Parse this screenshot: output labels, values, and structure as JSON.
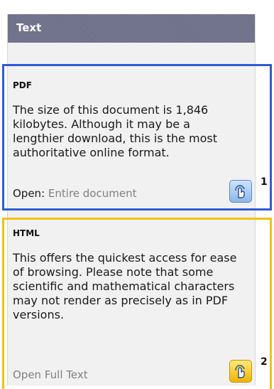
{
  "header": {
    "title": "Text"
  },
  "pdf": {
    "title": "PDF",
    "body": "The size of this document is 1,846 kilobytes. Although it may be a lengthier download, this is the most authoritative online format.",
    "open_label": "Open:",
    "open_link": "Entire document",
    "marker_number": "1",
    "marker_color": "#2f5bd4",
    "marker_icon": "hand-pointer-icon"
  },
  "html": {
    "title": "HTML",
    "body": "This offers the quickest access for ease of browsing. Please note that some scientific and mathematical characters may not render as precisely as in PDF versions.",
    "open_link": "Open Full Text",
    "marker_number": "2",
    "marker_color": "#f1c20f",
    "marker_icon": "hand-pointer-icon"
  },
  "colors": {
    "header_bg": "#6f7089",
    "panel_bg": "#f1f1f1",
    "link_text": "#808080"
  }
}
